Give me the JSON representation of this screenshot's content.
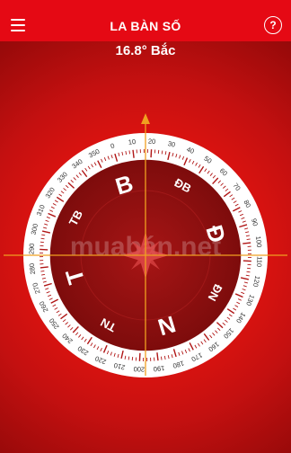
{
  "app": {
    "title": "LA BÀN SỐ",
    "menu_icon": "hamburger-menu-icon",
    "help_icon": "help-question-icon",
    "help_glyph": "?"
  },
  "readout": {
    "heading_text": "16.8° Bắc"
  },
  "compass": {
    "heading_deg": 16.8,
    "cardinals": [
      "B",
      "Đ",
      "N",
      "T"
    ],
    "intercardinals": [
      "ĐB",
      "ĐN",
      "TN",
      "TB"
    ],
    "degree_labels": [
      "0",
      "10",
      "20",
      "30",
      "40",
      "50",
      "60",
      "70",
      "80",
      "90",
      "100",
      "110",
      "120",
      "130",
      "140",
      "150",
      "160",
      "170",
      "180",
      "190",
      "200",
      "210",
      "220",
      "230",
      "240",
      "250",
      "260",
      "270",
      "280",
      "290",
      "300",
      "310",
      "320",
      "330",
      "340",
      "350"
    ],
    "watermark": "muabán.net",
    "colors": {
      "bezel": "#ffffff",
      "dial": "#8e1010",
      "accent": "#f0a020",
      "ticks": "#b01515"
    }
  }
}
